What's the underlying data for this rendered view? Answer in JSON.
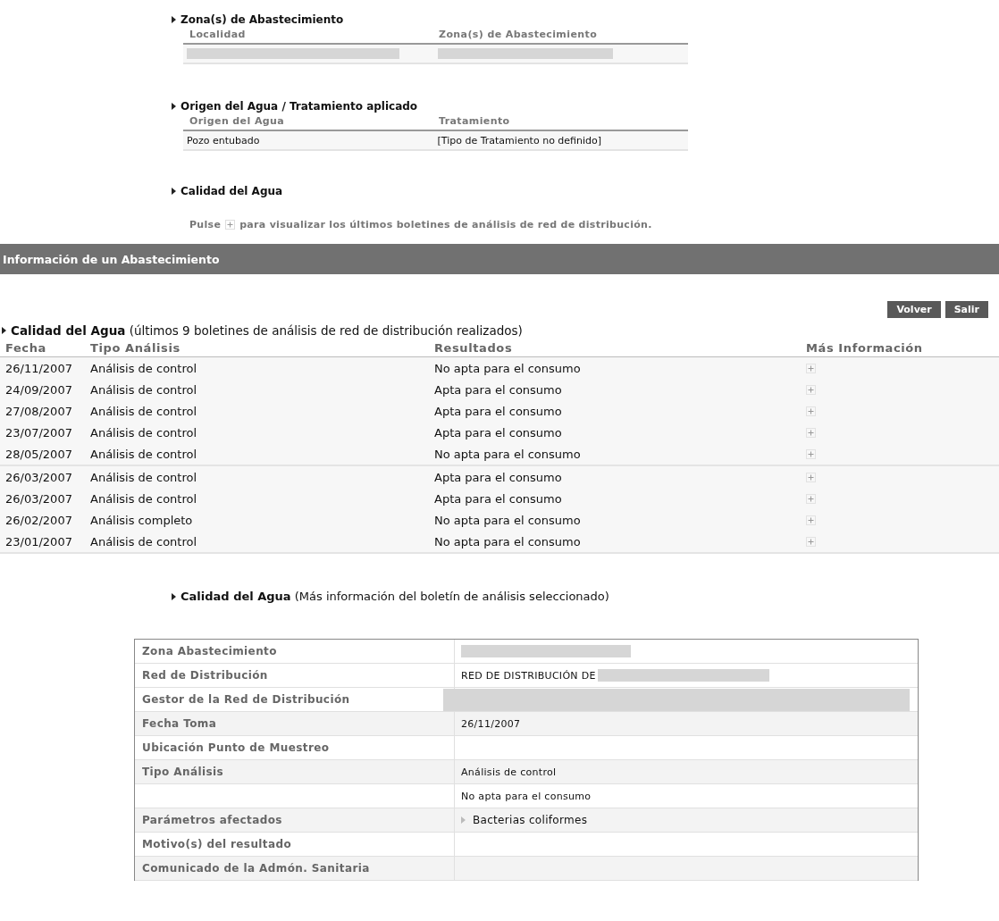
{
  "zonas": {
    "title": "Zona(s) de Abastecimiento",
    "columns": [
      "Localidad",
      "Zona(s) de Abastecimiento"
    ],
    "rows": [
      [
        {
          "redacted": true
        },
        {
          "redacted": true
        }
      ]
    ]
  },
  "origen": {
    "title": "Origen del Agua / Tratamiento aplicado",
    "columns": [
      "Origen del Agua",
      "Tratamiento"
    ],
    "rows": [
      [
        {
          "text": "Pozo entubado"
        },
        {
          "text": "[Tipo de Tratamiento no definido]"
        }
      ]
    ]
  },
  "calidad_intro": {
    "title": "Calidad del Agua",
    "hint_before": "Pulse",
    "hint_after": "para visualizar los últimos boletines de análisis de red de distribución."
  },
  "header_bar": {
    "title": "Información de un Abastecimiento"
  },
  "buttons": [
    "Volver",
    "Salir"
  ],
  "analisis": {
    "title": "Calidad del Agua",
    "subtitle": "(últimos 9 boletines de análisis de red de distribución realizados)",
    "columns": [
      "Fecha",
      "Tipo Análisis",
      "Resultados",
      "Más Información"
    ],
    "rows": [
      {
        "fecha": "26/11/2007",
        "tipo": "Análisis de control",
        "resultado": "No apta para el consumo"
      },
      {
        "fecha": "24/09/2007",
        "tipo": "Análisis de control",
        "resultado": "Apta para el consumo"
      },
      {
        "fecha": "27/08/2007",
        "tipo": "Análisis de control",
        "resultado": "Apta para el consumo"
      },
      {
        "fecha": "23/07/2007",
        "tipo": "Análisis de control",
        "resultado": "Apta para el consumo"
      },
      {
        "fecha": "28/05/2007",
        "tipo": "Análisis de control",
        "resultado": "No apta para el consumo"
      },
      {
        "fecha": "26/03/2007",
        "tipo": "Análisis de control",
        "resultado": "Apta para el consumo"
      },
      {
        "fecha": "26/03/2007",
        "tipo": "Análisis de control",
        "resultado": "Apta para el consumo"
      },
      {
        "fecha": "26/02/2007",
        "tipo": "Análisis completo",
        "resultado": "No apta para el consumo"
      },
      {
        "fecha": "23/01/2007",
        "tipo": "Análisis de control",
        "resultado": "No apta para el consumo"
      }
    ]
  },
  "detalle": {
    "title": "Calidad del Agua",
    "subtitle": "(Más información del boletín de análisis seleccionado)",
    "rows": [
      {
        "label": "Zona Abastecimiento",
        "value_redacted": true
      },
      {
        "label": "Red de Distribución",
        "value": "RED DE DISTRIBUCIÓN DE",
        "value_redacted": true
      },
      {
        "label": "Gestor de la Red de Distribución",
        "value_redacted": true,
        "kind": "wide"
      },
      {
        "label": "Fecha Toma",
        "value": "26/11/2007"
      },
      {
        "label": "Ubicación Punto de Muestreo"
      },
      {
        "label": "Tipo Análisis",
        "value": "Análisis de control"
      },
      {
        "value": "No apta para el consumo"
      },
      {
        "label": "Parámetros afectados",
        "value": "Bacterias coliformes",
        "kind": "list"
      },
      {
        "label": "Motivo(s) del resultado"
      },
      {
        "label": "Comunicado de la Admón. Sanitaria"
      }
    ]
  }
}
